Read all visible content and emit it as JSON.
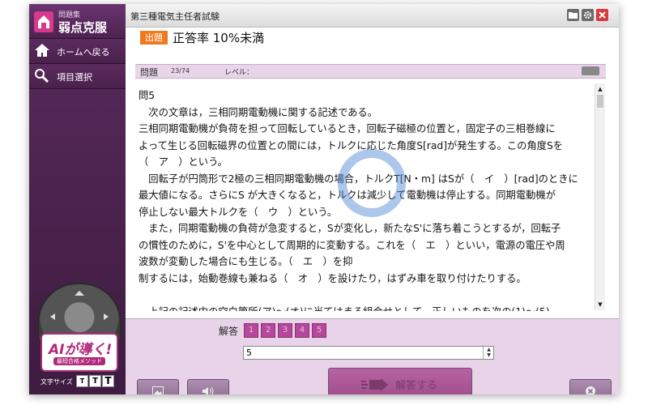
{
  "sidebar": {
    "brand_sub": "問題集",
    "brand_title": "弱点克服",
    "nav": [
      {
        "label": "ホームへ戻る",
        "icon": "home-icon"
      },
      {
        "label": "項目選択",
        "icon": "item-select-icon"
      }
    ],
    "ai_logo": "AIが導く!",
    "ai_sub": "最短合格メソッド",
    "font_size_label": "文字サイズ",
    "font_sizes": [
      "T",
      "T",
      "T"
    ]
  },
  "window": {
    "title": "第三種電気主任者試験"
  },
  "header": {
    "tag": "出題",
    "title": "正答率 10%未満"
  },
  "question_bar": {
    "label": "問題",
    "number": "23/74",
    "level_label": "レベル："
  },
  "question": {
    "lines": [
      "問5",
      "　次の文章は，三相同期電動機に関する記述である。",
      "三相同期電動機が負荷を担って回転しているとき，回転子磁極の位置と，固定子の三相巻線に",
      "よって生じる回転磁界の位置との間には，トルクに応じた角度S[rad]が発生する。この角度Sを",
      "（　ア　）という。",
      "　回転子が円筒形で2極の三相同期電動機の場合，トルクT[N・m] はSが（　イ　）[rad]のときに",
      "最大値になる。さらにS が大きくなると，トルクは減少して電動機は停止する。同期電動機が",
      "停止しない最大トルクを（　ウ　）という。",
      "　また，同期電動機の負荷が急変すると，Sが変化し，新たなS'に落ち着こうとするが，回転子",
      "の慣性のために，S'を中心として周期的に変動する。これを（　エ　）といい，電源の電圧や周",
      "波数が変動した場合にも生じる。（　エ　）を抑",
      "制するには，始動巻線も兼ねる（　オ　）を設けたり，はずみ車を取り付けたりする。",
      "",
      "　上記の記述中の空白箇所(ア)～(オ)に当てはまる組合せとして，正しいものを次の(1)～(5)"
    ]
  },
  "answer": {
    "label": "解答",
    "choices": [
      "1",
      "2",
      "3",
      "4",
      "5"
    ],
    "value": "5",
    "submit_label": "解答する"
  }
}
